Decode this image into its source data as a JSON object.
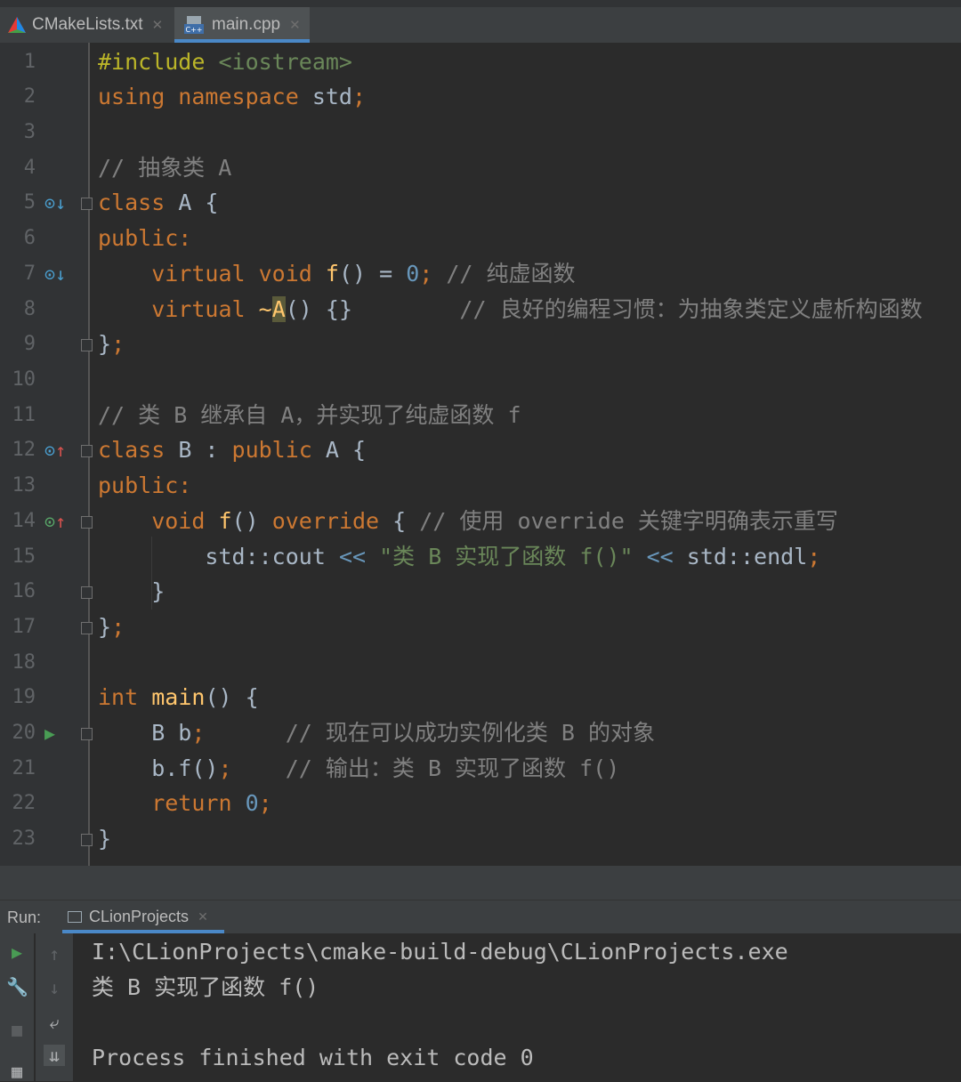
{
  "tabs": [
    {
      "label": "CMakeLists.txt",
      "icon": "cmake-icon",
      "active": false
    },
    {
      "label": "main.cpp",
      "icon": "cpp-file-icon",
      "active": true
    }
  ],
  "editor": {
    "line_numbers": [
      "1",
      "2",
      "3",
      "4",
      "5",
      "6",
      "7",
      "8",
      "9",
      "10",
      "11",
      "12",
      "13",
      "14",
      "15",
      "16",
      "17",
      "18",
      "19",
      "20",
      "21",
      "22",
      "23"
    ],
    "lines": {
      "l1": {
        "a": "#include ",
        "b": "<iostream>"
      },
      "l2": {
        "a": "using namespace ",
        "b": "std",
        "c": ";"
      },
      "l4": {
        "a": "// 抽象类 A"
      },
      "l5": {
        "a": "class ",
        "b": "A {"
      },
      "l6": {
        "a": "public:"
      },
      "l7": {
        "a": "    virtual void ",
        "b": "f",
        "c": "() = ",
        "d": "0",
        "e": "; ",
        "f": "// 纯虚函数"
      },
      "l8": {
        "a": "    virtual ",
        "b": "~",
        "c": "A",
        "d": "() {}",
        "e": "        // 良好的编程习惯：为抽象类定义虚析构函数"
      },
      "l9": {
        "a": "}",
        "b": ";"
      },
      "l11": {
        "a": "// 类 B 继承自 A，并实现了纯虚函数 f"
      },
      "l12": {
        "a": "class ",
        "b": "B : ",
        "c": "public ",
        "d": "A {"
      },
      "l13": {
        "a": "public:"
      },
      "l14": {
        "a": "    void ",
        "b": "f",
        "c": "() ",
        "d": "override ",
        "e": "{ ",
        "f": "// 使用 override 关键字明确表示重写"
      },
      "l15": {
        "a": "        std::cout ",
        "b": "<< ",
        "c": "\"类 B 实现了函数 f()\"",
        "d": " << ",
        "e": "std::endl",
        "f": ";"
      },
      "l16": {
        "a": "    }"
      },
      "l17": {
        "a": "}",
        "b": ";"
      },
      "l19": {
        "a": "int ",
        "b": "main",
        "c": "() {"
      },
      "l20": {
        "a": "    B b",
        "b": ";",
        "c": "      // 现在可以成功实例化类 B 的对象"
      },
      "l21": {
        "a": "    b.f()",
        "b": ";",
        "c": "    // 输出：类 B 实现了函数 f()"
      },
      "l22": {
        "a": "    return ",
        "b": "0",
        "c": ";"
      },
      "l23": {
        "a": "}"
      }
    }
  },
  "run_panel": {
    "label": "Run:",
    "tab_label": "CLionProjects",
    "output": [
      "I:\\CLionProjects\\cmake-build-debug\\CLionProjects.exe",
      "类 B 实现了函数 f()",
      "",
      "Process finished with exit code 0"
    ]
  },
  "colors": {
    "background": "#2b2b2b",
    "keyword": "#cc7832",
    "string": "#6a8759",
    "number": "#6897bb",
    "comment": "#808080",
    "function": "#ffc66d",
    "accent": "#4a88c7"
  }
}
